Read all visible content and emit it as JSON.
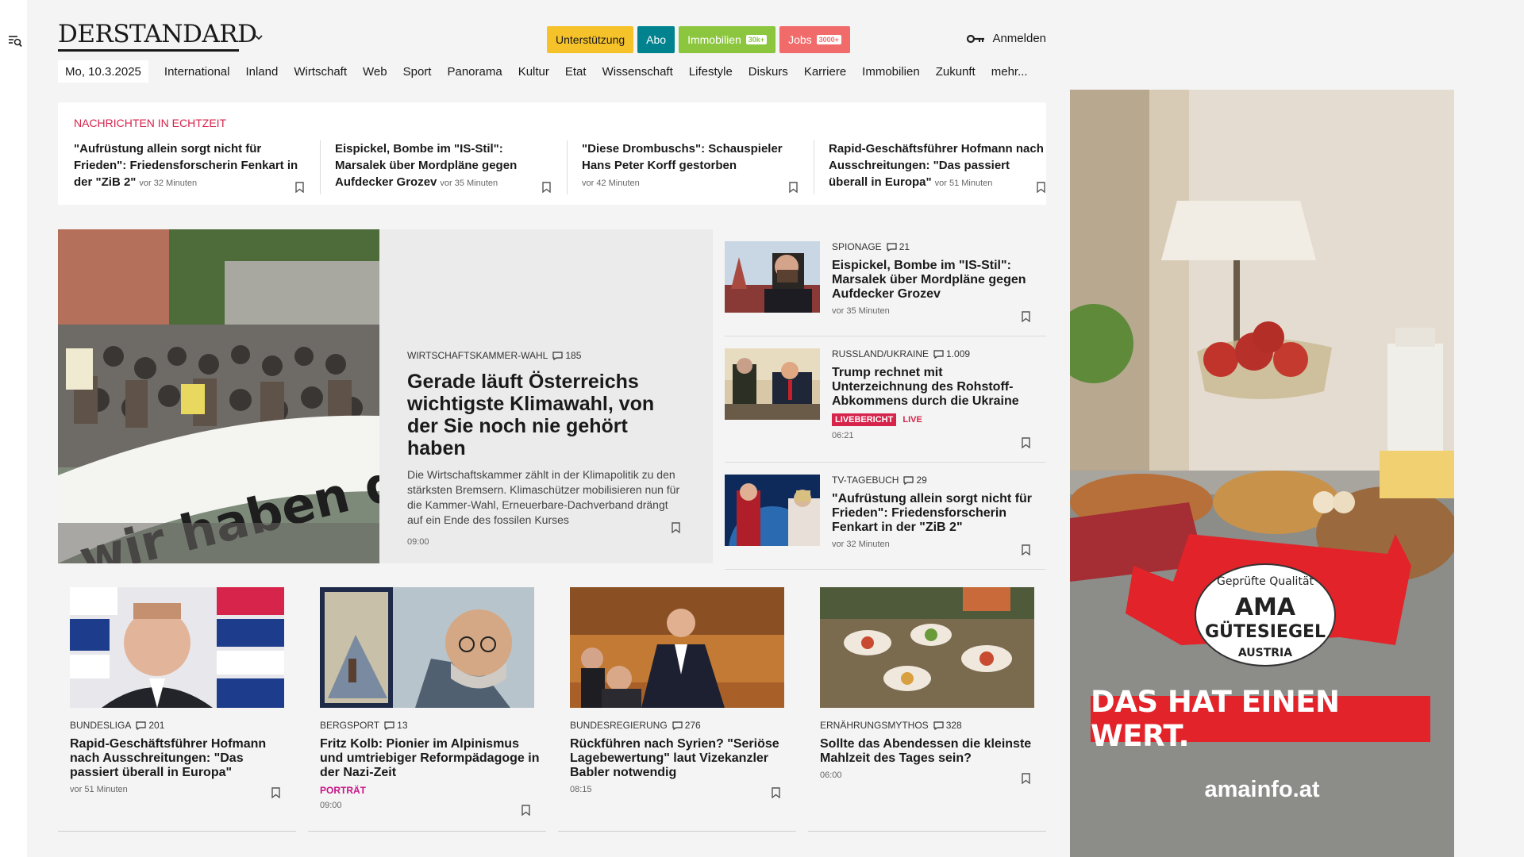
{
  "header": {
    "logo": "DERSTANDARD",
    "pills": [
      {
        "label": "Unterstützung",
        "bg": "#f5c22a",
        "fg": "#1a1a1a",
        "mini": ""
      },
      {
        "label": "Abo",
        "bg": "#00838f",
        "fg": "#ffffff",
        "mini": ""
      },
      {
        "label": "Immobilien",
        "bg": "#8cc63f",
        "fg": "#ffffff",
        "mini": "30k+"
      },
      {
        "label": "Jobs",
        "bg": "#f26b6b",
        "fg": "#ffffff",
        "mini": "3000+"
      }
    ],
    "login": "Anmelden"
  },
  "nav": {
    "date": "Mo, 10.3.2025",
    "items": [
      "International",
      "Inland",
      "Wirtschaft",
      "Web",
      "Sport",
      "Panorama",
      "Kultur",
      "Etat",
      "Wissenschaft",
      "Lifestyle",
      "Diskurs",
      "Karriere",
      "Immobilien",
      "Zukunft",
      "mehr..."
    ]
  },
  "ticker": {
    "heading": "NACHRICHTEN IN ECHTZEIT",
    "items": [
      {
        "title": "\"Aufrüstung allein sorgt nicht für Frieden\": Friedensforscherin Fenkart in der \"ZiB 2\"",
        "time": "vor 32 Minuten"
      },
      {
        "title": "Eispickel, Bombe im \"IS-Stil\": Marsalek über Mordpläne gegen Aufdecker Grozev",
        "time": "vor 35 Minuten"
      },
      {
        "title": "\"Diese Drombuschs\": Schauspieler Hans Peter Korff gestorben",
        "time": "vor 42 Minuten"
      },
      {
        "title": "Rapid-Geschäftsführer Hofmann nach Ausschreitungen: \"Das passiert überall in Europa\"",
        "time": "vor 51 Minuten"
      }
    ]
  },
  "hero": {
    "kicker": "WIRTSCHAFTSKAMMER-WAHL",
    "comments": "185",
    "title": "Gerade läuft Österreichs wichtigste Klimawahl, von der Sie noch nie gehört haben",
    "teaser": "Die Wirtschaftskammer zählt in der Klimapolitik zu den stärksten Bremsern. Klimaschützer mobilisieren nun für die Kammer-Wahl, Erneuerbare-Dachverband drängt auf ein Ende des fossilen Kurses",
    "time": "09:00",
    "banner_text": "wir haben die W"
  },
  "side": [
    {
      "kicker": "SPIONAGE",
      "comments": "21",
      "title": "Eispickel, Bombe im \"IS-Stil\": Marsalek über Mordpläne gegen Aufdecker Grozev",
      "time": "vor 35 Minuten",
      "badge": "",
      "live": ""
    },
    {
      "kicker": "RUSSLAND/UKRAINE",
      "comments": "1.009",
      "title": "Trump rechnet mit Unterzeichnung des Rohstoff-Abkommens durch die Ukraine",
      "time": "06:21",
      "badge": "LIVEBERICHT",
      "live": "LIVE"
    },
    {
      "kicker": "TV-TAGEBUCH",
      "comments": "29",
      "title": "\"Aufrüstung allein sorgt nicht für Frieden\": Friedensforscherin Fenkart in der \"ZiB 2\"",
      "time": "vor 32 Minuten",
      "badge": "",
      "live": ""
    }
  ],
  "bottom": [
    {
      "kicker": "BUNDESLIGA",
      "comments": "201",
      "title": "Rapid-Geschäftsführer Hofmann nach Ausschreitungen: \"Das passiert überall in Europa\"",
      "label": "",
      "time": "vor 51 Minuten"
    },
    {
      "kicker": "BERGSPORT",
      "comments": "13",
      "title": "Fritz Kolb: Pionier im Alpinismus und umtriebiger Reformpädagoge in der Nazi-Zeit",
      "label": "PORTRÄT",
      "time": "09:00"
    },
    {
      "kicker": "BUNDESREGIERUNG",
      "comments": "276",
      "title": "Rückführen nach Syrien? \"Seriöse Lagebewertung\" laut Vizekanzler Babler notwendig",
      "label": "",
      "time": "08:15"
    },
    {
      "kicker": "ERNÄHRUNGSMYTHOS",
      "comments": "328",
      "title": "Sollte das Abendessen die kleinste Mahlzeit des Tages sein?",
      "label": "",
      "time": "06:00"
    }
  ],
  "ad": {
    "seal_top": "Geprüfte Qualität",
    "seal_main1": "AMA",
    "seal_main2": "GÜTESIEGEL",
    "seal_bottom": "AUSTRIA",
    "headline": "DAS HAT EINEN WERT.",
    "url": "amainfo.at"
  },
  "icons": {
    "menu": "menu-search-icon",
    "chevron": "chevron-down-icon",
    "key": "key-icon",
    "bookmark": "bookmark-icon",
    "comment": "comment-icon"
  }
}
